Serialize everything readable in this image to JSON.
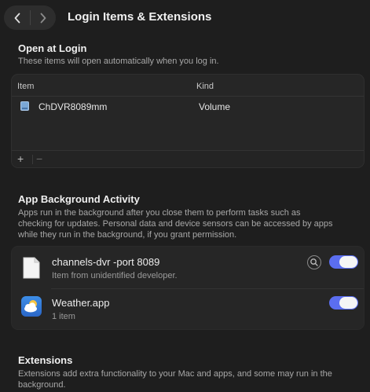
{
  "window": {
    "title": "Login Items & Extensions"
  },
  "open_at_login": {
    "title": "Open at Login",
    "description": "These items will open automatically when you log in.",
    "columns": {
      "item": "Item",
      "kind": "Kind"
    },
    "rows": [
      {
        "item": "ChDVR8089mm",
        "kind": "Volume",
        "icon": "volume-icon"
      }
    ],
    "footer": {
      "add": "+",
      "remove": "−"
    }
  },
  "background_activity": {
    "title": "App Background Activity",
    "description_lines": [
      "Apps run in the background after you close them to perform tasks such as",
      "checking for updates. Personal data and device sensors can be accessed by apps",
      "while they run in the background, if you grant permission."
    ],
    "items": [
      {
        "name": "channels-dvr -port 8089",
        "subtitle": "Item from unidentified developer.",
        "icon": "document-icon",
        "enabled": true,
        "has_info": true
      },
      {
        "name": "Weather.app",
        "subtitle": "1 item",
        "icon": "weather-app-icon",
        "enabled": true,
        "has_info": false
      }
    ]
  },
  "extensions": {
    "title": "Extensions",
    "description_lines": [
      "Extensions add extra functionality to your Mac and apps, and some may run in the",
      "background."
    ]
  },
  "colors": {
    "background": "#1e1e1e",
    "panel": "#262626",
    "toggle_on": "#5b6ef0"
  }
}
